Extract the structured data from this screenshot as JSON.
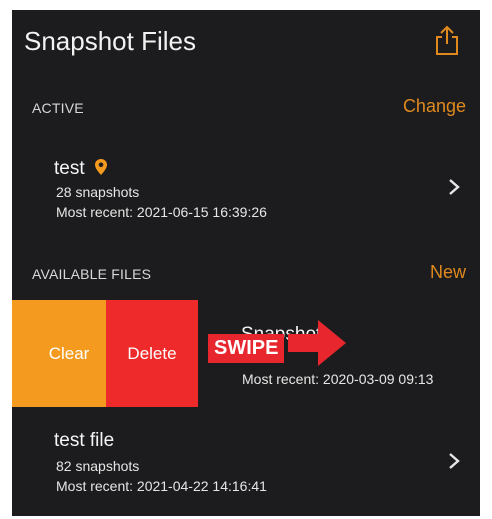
{
  "header": {
    "title": "Snapshot Files",
    "share_icon": "share-icon"
  },
  "active_section": {
    "label": "ACTIVE",
    "action": "Change"
  },
  "active_file": {
    "name": "test",
    "location_icon": "location-pin-icon",
    "count": "28 snapshots",
    "recent": "Most recent: 2021-06-15 16:39:26"
  },
  "available_section": {
    "label": "AVAILABLE FILES",
    "action": "New"
  },
  "swiped_row": {
    "clear_label": "Clear",
    "delete_label": "Delete",
    "name": "Snapshots",
    "recent": "Most recent: 2020-03-09 09:13"
  },
  "overlay": {
    "swipe_label": "SWIPE"
  },
  "other_file": {
    "name": "test file",
    "count": "82 snapshots",
    "recent": "Most recent: 2021-04-22 14:16:41"
  },
  "colors": {
    "accent": "#e08a1e",
    "clear": "#f39a1f",
    "delete": "#ee2a2a",
    "background": "#1c1c1e"
  }
}
